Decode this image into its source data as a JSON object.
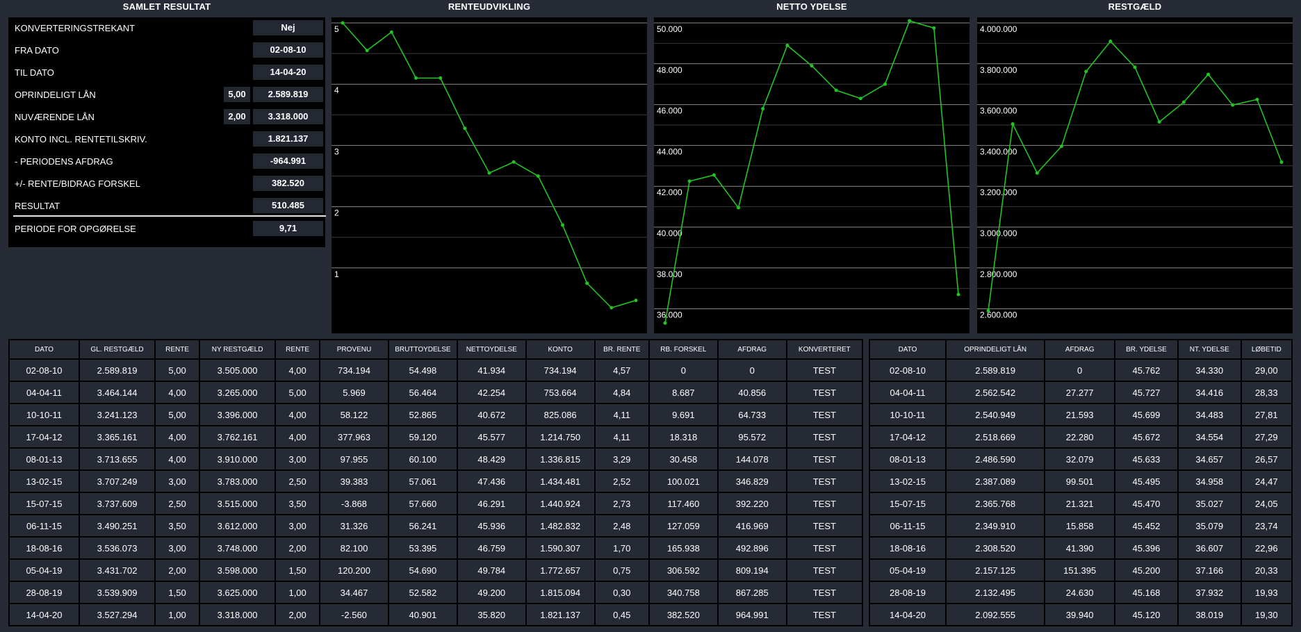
{
  "titles": {
    "summary": "SAMLET RESULTAT",
    "rente": "RENTEUDVIKLING",
    "netto": "NETTO YDELSE",
    "restgaeld": "RESTGÆLD"
  },
  "summary": {
    "rows": [
      {
        "label": "KONVERTERINGSTREKANT",
        "value": "Nej"
      },
      {
        "label": "FRA DATO",
        "value": "02-08-10"
      },
      {
        "label": "TIL DATO",
        "value": "14-04-20"
      },
      {
        "label": "OPRINDELIGT LÅN",
        "rate": "5,00",
        "value": "2.589.819"
      },
      {
        "label": "NUVÆRENDE LÅN",
        "rate": "2,00",
        "value": "3.318.000"
      },
      {
        "label": "KONTO INCL. RENTETILSKRIV.",
        "value": "1.821.137"
      },
      {
        "label": "- PERIODENS AFDRAG",
        "value": "-964.991"
      },
      {
        "label": "+/- RENTE/BIDRAG FORSKEL",
        "value": "382.520"
      },
      {
        "label": "RESULTAT",
        "value": "510.485"
      },
      {
        "label": "PERIODE FOR OPGØRELSE",
        "value": "9,71"
      }
    ]
  },
  "colors": {
    "line": "#22c422",
    "grid": "#8a8a8a",
    "bg": "#000000"
  },
  "chart_data": [
    {
      "type": "line",
      "title": "RENTEUDVIKLING",
      "ylim": [
        0,
        5
      ],
      "yticks": [
        1,
        2,
        3,
        4,
        5
      ],
      "ytick_labels": [
        "1",
        "2",
        "3",
        "4",
        "5"
      ],
      "grid": true,
      "values": [
        5.0,
        4.55,
        4.85,
        4.1,
        4.1,
        3.28,
        2.55,
        2.73,
        2.5,
        1.7,
        0.75,
        0.35,
        0.47
      ]
    },
    {
      "type": "line",
      "title": "NETTO YDELSE",
      "ylim": [
        35000,
        50000
      ],
      "yticks": [
        36000,
        38000,
        40000,
        42000,
        44000,
        46000,
        48000,
        50000
      ],
      "ytick_labels": [
        "36.000",
        "38.000",
        "40.000",
        "42.000",
        "44.000",
        "46.000",
        "48.000",
        "50.000"
      ],
      "grid": true,
      "values": [
        35300,
        42250,
        42550,
        40950,
        45800,
        48900,
        47900,
        46700,
        46300,
        47000,
        50100,
        49750,
        36700
      ]
    },
    {
      "type": "line",
      "title": "RESTGÆLD",
      "ylim": [
        2500000,
        4000000
      ],
      "yticks": [
        2600000,
        2800000,
        3000000,
        3200000,
        3400000,
        3600000,
        3800000,
        4000000
      ],
      "ytick_labels": [
        "2.600.000",
        "2.800.000",
        "3.000.000",
        "3.200.000",
        "3.400.000",
        "3.600.000",
        "3.800.000",
        "4.000.000"
      ],
      "grid": true,
      "values": [
        2590000,
        3505000,
        3265000,
        3396000,
        3762000,
        3910000,
        3783000,
        3515000,
        3612000,
        3748000,
        3598000,
        3625000,
        3318000
      ]
    }
  ],
  "table_left": {
    "headers": [
      "DATO",
      "GL. RESTGÆLD",
      "RENTE",
      "NY RESTGÆLD",
      "RENTE",
      "PROVENU",
      "BRUTTOYDELSE",
      "NETTOYDELSE",
      "KONTO",
      "BR. RENTE",
      "RB. FORSKEL",
      "AFDRAG",
      "KONVERTERET"
    ],
    "rows": [
      [
        "02-08-10",
        "2.589.819",
        "5,00",
        "3.505.000",
        "4,00",
        "734.194",
        "54.498",
        "41.934",
        "734.194",
        "4,57",
        "0",
        "0",
        "TEST"
      ],
      [
        "04-04-11",
        "3.464.144",
        "4,00",
        "3.265.000",
        "5,00",
        "5.969",
        "56.464",
        "42.254",
        "753.664",
        "4,84",
        "8.687",
        "40.856",
        "TEST"
      ],
      [
        "10-10-11",
        "3.241.123",
        "5,00",
        "3.396.000",
        "4,00",
        "58.122",
        "52.865",
        "40.672",
        "825.086",
        "4,11",
        "9.691",
        "64.733",
        "TEST"
      ],
      [
        "17-04-12",
        "3.365.161",
        "4,00",
        "3.762.161",
        "4,00",
        "377.963",
        "59.120",
        "45.577",
        "1.214.750",
        "4,11",
        "18.318",
        "95.572",
        "TEST"
      ],
      [
        "08-01-13",
        "3.713.655",
        "4,00",
        "3.910.000",
        "3,00",
        "97.955",
        "60.100",
        "48.429",
        "1.336.815",
        "3,29",
        "30.458",
        "144.078",
        "TEST"
      ],
      [
        "13-02-15",
        "3.707.249",
        "3,00",
        "3.783.000",
        "2,50",
        "39.383",
        "57.061",
        "47.436",
        "1.434.481",
        "2,52",
        "100.021",
        "346.829",
        "TEST"
      ],
      [
        "15-07-15",
        "3.737.609",
        "2,50",
        "3.515.000",
        "3,50",
        "-3.868",
        "57.660",
        "46.291",
        "1.440.924",
        "2,73",
        "117.460",
        "392.220",
        "TEST"
      ],
      [
        "06-11-15",
        "3.490.251",
        "3,50",
        "3.612.000",
        "3,00",
        "31.326",
        "56.241",
        "45.936",
        "1.482.832",
        "2,48",
        "127.059",
        "416.969",
        "TEST"
      ],
      [
        "18-08-16",
        "3.536.073",
        "3,00",
        "3.748.000",
        "2,00",
        "82.100",
        "53.395",
        "46.759",
        "1.590.307",
        "1,70",
        "165.938",
        "492.896",
        "TEST"
      ],
      [
        "05-04-19",
        "3.431.702",
        "2,00",
        "3.598.000",
        "1,50",
        "120.200",
        "54.690",
        "49.784",
        "1.772.657",
        "0,75",
        "306.592",
        "809.194",
        "TEST"
      ],
      [
        "28-08-19",
        "3.539.909",
        "1,50",
        "3.625.000",
        "1,00",
        "34.467",
        "52.582",
        "49.200",
        "1.815.094",
        "0,30",
        "340.758",
        "867.285",
        "TEST"
      ],
      [
        "14-04-20",
        "3.527.294",
        "1,00",
        "3.318.000",
        "2,00",
        "-2.560",
        "40.901",
        "35.820",
        "1.821.137",
        "0,45",
        "382.520",
        "964.991",
        "TEST"
      ]
    ]
  },
  "table_right": {
    "headers": [
      "DATO",
      "OPRINDELIGT LÅN",
      "AFDRAG",
      "BR. YDELSE",
      "NT. YDELSE",
      "LØBETID"
    ],
    "rows": [
      [
        "02-08-10",
        "2.589.819",
        "0",
        "45.762",
        "34.330",
        "29,00"
      ],
      [
        "04-04-11",
        "2.562.542",
        "27.277",
        "45.727",
        "34.416",
        "28,33"
      ],
      [
        "10-10-11",
        "2.540.949",
        "21.593",
        "45.699",
        "34.483",
        "27,81"
      ],
      [
        "17-04-12",
        "2.518.669",
        "22.280",
        "45.672",
        "34.554",
        "27,29"
      ],
      [
        "08-01-13",
        "2.486.590",
        "32.079",
        "45.633",
        "34.657",
        "26,57"
      ],
      [
        "13-02-15",
        "2.387.089",
        "99.501",
        "45.495",
        "34.958",
        "24,47"
      ],
      [
        "15-07-15",
        "2.365.768",
        "21.321",
        "45.470",
        "35.027",
        "24,05"
      ],
      [
        "06-11-15",
        "2.349.910",
        "15.858",
        "45.452",
        "35.079",
        "23,74"
      ],
      [
        "18-08-16",
        "2.308.520",
        "41.390",
        "45.396",
        "36.607",
        "22,96"
      ],
      [
        "05-04-19",
        "2.157.125",
        "151.395",
        "45.200",
        "37.166",
        "20,33"
      ],
      [
        "28-08-19",
        "2.132.495",
        "24.630",
        "45.168",
        "37.932",
        "19,93"
      ],
      [
        "14-04-20",
        "2.092.555",
        "39.940",
        "45.120",
        "38.019",
        "19,30"
      ]
    ]
  }
}
